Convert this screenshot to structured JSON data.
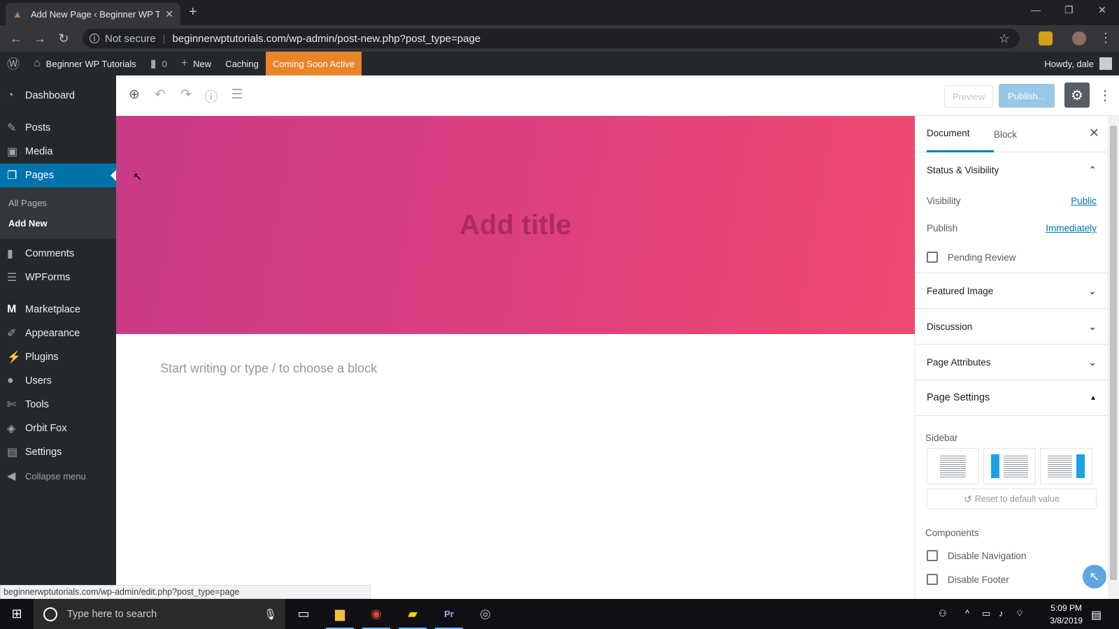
{
  "browser": {
    "tab_title": "Add New Page ‹ Beginner WP Tu",
    "security": "Not secure",
    "url": "beginnerwptutorials.com/wp-admin/post-new.php?post_type=page",
    "status_url": "beginnerwptutorials.com/wp-admin/edit.php?post_type=page"
  },
  "adminbar": {
    "site_name": "Beginner WP Tutorials",
    "comments_count": "0",
    "new_label": "New",
    "caching_label": "Caching",
    "coming_soon": "Coming Soon Active",
    "howdy": "Howdy, dale"
  },
  "sidebar": {
    "items": [
      {
        "label": "Dashboard",
        "icon": "dashboard-icon"
      },
      {
        "label": "Posts",
        "icon": "pin-icon"
      },
      {
        "label": "Media",
        "icon": "media-icon"
      },
      {
        "label": "Pages",
        "icon": "pages-icon"
      },
      {
        "label": "Comments",
        "icon": "comment-icon"
      },
      {
        "label": "WPForms",
        "icon": "forms-icon"
      },
      {
        "label": "Marketplace",
        "icon": "marketplace-icon"
      },
      {
        "label": "Appearance",
        "icon": "brush-icon"
      },
      {
        "label": "Plugins",
        "icon": "plug-icon"
      },
      {
        "label": "Users",
        "icon": "user-icon"
      },
      {
        "label": "Tools",
        "icon": "wrench-icon"
      },
      {
        "label": "Orbit Fox",
        "icon": "fox-icon"
      },
      {
        "label": "Settings",
        "icon": "settings-icon"
      }
    ],
    "submenu": [
      {
        "label": "All Pages"
      },
      {
        "label": "Add New"
      }
    ],
    "collapse": "Collapse menu"
  },
  "toolbar": {
    "preview": "Preview",
    "publish": "Publish..."
  },
  "editor": {
    "title_placeholder": "Add title",
    "block_placeholder": "Start writing or type / to choose a block"
  },
  "panel": {
    "tabs": {
      "document": "Document",
      "block": "Block"
    },
    "status": {
      "heading": "Status & Visibility",
      "visibility_label": "Visibility",
      "visibility_value": "Public",
      "publish_label": "Publish",
      "publish_value": "Immediately",
      "pending": "Pending Review"
    },
    "featured_image": "Featured Image",
    "discussion": "Discussion",
    "page_attributes": "Page Attributes",
    "page_settings": {
      "heading": "Page Settings",
      "sidebar_label": "Sidebar",
      "reset": "Reset to default value",
      "components_label": "Components",
      "disable_navigation": "Disable Navigation",
      "disable_footer": "Disable Footer"
    }
  },
  "taskbar": {
    "search_placeholder": "Type here to search",
    "time": "5:09 PM",
    "date": "3/8/2019"
  },
  "colors": {
    "wp_admin_dark": "#23282d",
    "wp_blue": "#0073aa",
    "coming_soon": "#e9842a",
    "hero_start": "#c93b87",
    "hero_end": "#f04b6f"
  }
}
